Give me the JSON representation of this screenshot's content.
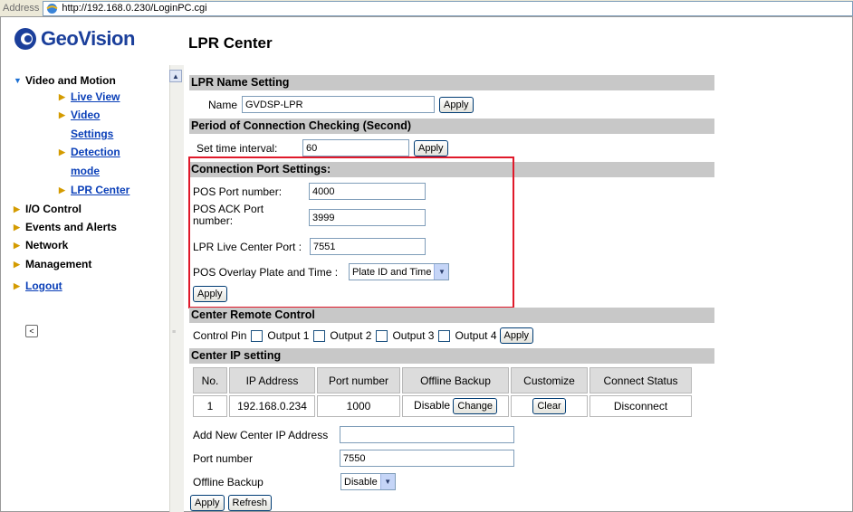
{
  "address_bar": {
    "label": "Address",
    "url": "http://192.168.0.230/LoginPC.cgi"
  },
  "brand": {
    "name": "GeoVision"
  },
  "nav": {
    "video_and_motion": "Video and Motion",
    "live_view": "Live View",
    "video_settings_1": "Video",
    "video_settings_2": "Settings",
    "detection_mode_1": "Detection",
    "detection_mode_2": "mode",
    "lpr_center": "LPR Center",
    "io_control": "I/O Control",
    "events_and_alerts": "Events and Alerts",
    "network": "Network",
    "management": "Management",
    "logout": "Logout",
    "collapse_glyph": "<"
  },
  "page": {
    "title": "LPR Center"
  },
  "lpr_name": {
    "header": "LPR Name Setting",
    "label": "Name",
    "value": "GVDSP-LPR",
    "apply": "Apply"
  },
  "period": {
    "header": "Period of Connection Checking (Second)",
    "label": "Set time interval:",
    "value": "60",
    "apply": "Apply"
  },
  "connection_port": {
    "header": "Connection Port Settings:",
    "pos_port_label": "POS Port number:",
    "pos_port_value": "4000",
    "pos_ack_label_1": "POS ACK Port",
    "pos_ack_label_2": "number:",
    "pos_ack_value": "3999",
    "lpr_live_label": "LPR Live Center Port :",
    "lpr_live_value": "7551",
    "overlay_label": "POS Overlay Plate and Time :",
    "overlay_value": "Plate ID and Time",
    "apply": "Apply"
  },
  "center_remote": {
    "header": "Center Remote Control",
    "label": "Control Pin",
    "outputs": [
      "Output 1",
      "Output 2",
      "Output 3",
      "Output 4"
    ],
    "apply": "Apply"
  },
  "center_ip": {
    "header": "Center IP setting",
    "columns": [
      "No.",
      "IP Address",
      "Port number",
      "Offline Backup",
      "Customize",
      "Connect Status"
    ],
    "rows": [
      {
        "no": "1",
        "ip": "192.168.0.234",
        "port": "1000",
        "backup": "Disable",
        "change": "Change",
        "clear": "Clear",
        "status": "Disconnect"
      }
    ],
    "add_label": "Add New Center IP Address",
    "add_value": "",
    "port_label": "Port number",
    "port_value": "7550",
    "backup_label": "Offline Backup",
    "backup_value": "Disable",
    "apply": "Apply",
    "refresh": "Refresh"
  },
  "colors": {
    "accent_red": "#e0192a",
    "link_blue": "#0a3fb8",
    "section_gray": "#c8c8c8"
  }
}
